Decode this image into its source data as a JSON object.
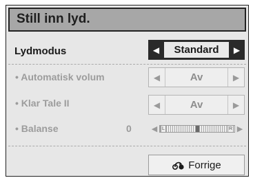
{
  "title": "Still inn lyd.",
  "sound_mode": {
    "label": "Lydmodus",
    "value": "Standard",
    "left_icon": "arrow-left-icon",
    "right_icon": "arrow-right-icon"
  },
  "auto_volume": {
    "label": "• Automatisk volum",
    "value": "Av"
  },
  "clear_voice": {
    "label": "• Klar Tale II",
    "value": "Av"
  },
  "balance": {
    "label": "• Balanse",
    "value": "0",
    "left_cap": "L",
    "right_cap": "R",
    "position_fraction": 0.5
  },
  "back_button": {
    "label": "Forrige",
    "icon": "back-icon"
  },
  "colors": {
    "accent": "#2a2a2a",
    "title_bg": "#a7a7a7",
    "panel_bg": "#e7e7e7",
    "disabled_text": "#9c9c9c"
  }
}
